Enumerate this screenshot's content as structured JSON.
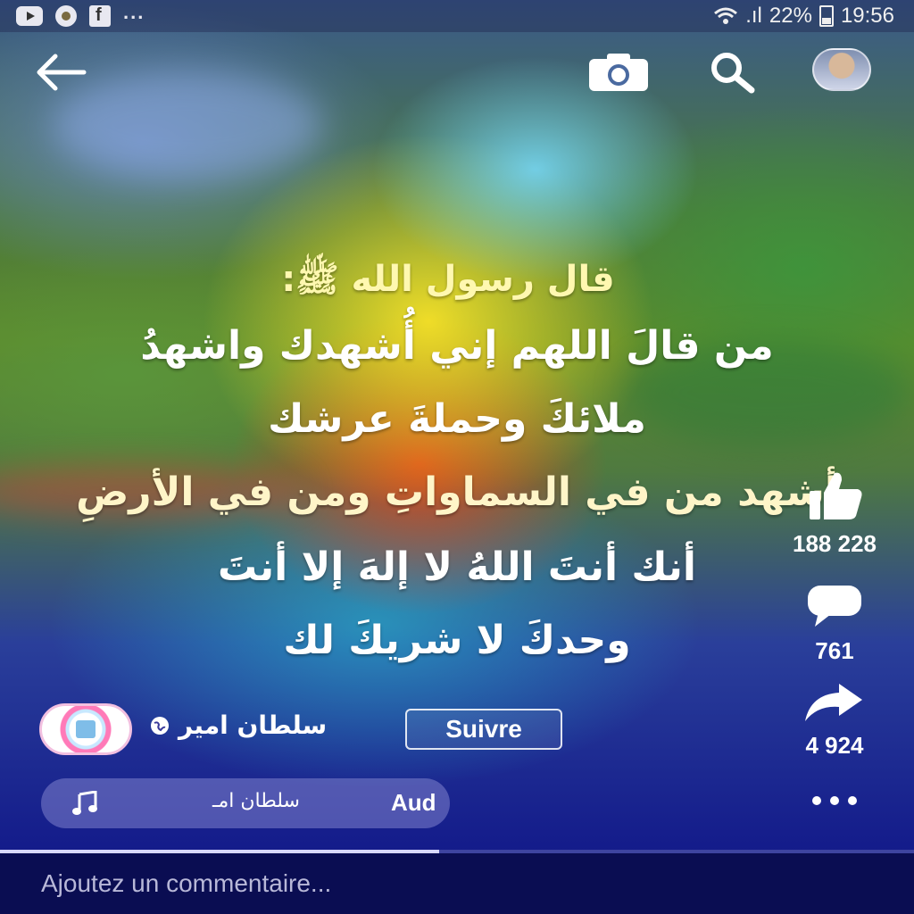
{
  "status_bar": {
    "notif_overflow": "...",
    "signal_text": ".ıl",
    "battery_percent": "22%",
    "time": "19:56",
    "left_icons": [
      "youtube-icon",
      "record-icon",
      "flipboard-icon"
    ]
  },
  "top_bar": {
    "icons": [
      "back-arrow-icon",
      "camera-icon",
      "search-icon",
      "profile-avatar"
    ]
  },
  "post": {
    "title": "قال رسول الله ﷺ:",
    "lines": [
      "من قالَ اللهم إني أُشهدك واشهدُ",
      "ملائكَ وحملةَ عرشك",
      "أشهد من في السماواتِ ومن في الأرضِ",
      "أنك أنتَ اللهُ لا إلهَ إلا أنتَ",
      "وحدكَ لا شريكَ لك"
    ]
  },
  "actions": {
    "likes": "188 228",
    "comments": "761",
    "shares": "4 924"
  },
  "author": {
    "name": "سلطان امير",
    "follow_label": "Suivre"
  },
  "audio": {
    "artist": "سلطان امـ",
    "label": "Aud"
  },
  "progress_fraction": 0.48,
  "comment": {
    "placeholder": "Ajoutez un commentaire..."
  },
  "colors": {
    "title_text": "#fff8b0",
    "comment_bar": "#0a0d52"
  }
}
